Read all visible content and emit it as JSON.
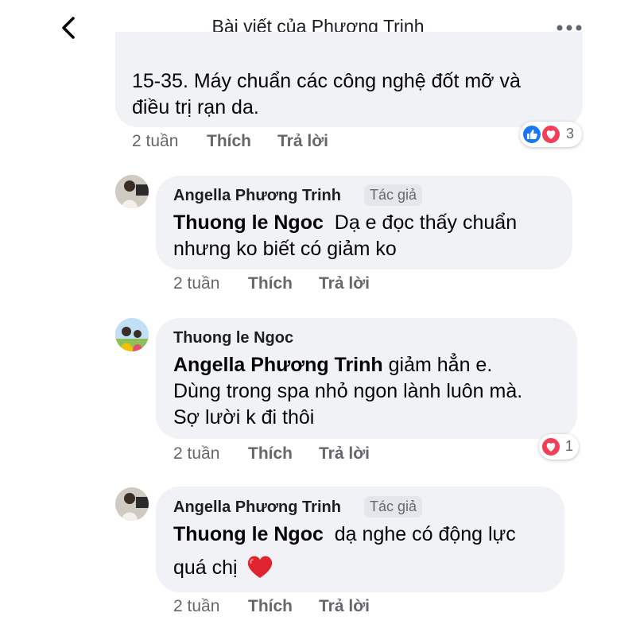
{
  "header": {
    "title": "Bài viết của Phương Trinh",
    "back_icon": "chevron-left-icon",
    "more_icon": "more-dots-icon"
  },
  "comments": [
    {
      "text_lines": [
        "15-35. Máy chuẩn các công nghệ đốt mỡ và",
        "điều trị rạn da."
      ],
      "time": "2 tuần",
      "like": "Thích",
      "reply": "Trả lời",
      "reactions": {
        "icons": [
          "like-icon",
          "heart-icon"
        ],
        "count": "3"
      }
    },
    {
      "author": "Angella Phương Trinh",
      "badge": "Tác giả",
      "mention": "Thuong le Ngoc",
      "line1": "Dạ e đọc thấy chuẩn",
      "line2": "nhưng ko biết có giảm ko",
      "time": "2 tuần",
      "like": "Thích",
      "reply": "Trả lời"
    },
    {
      "author": "Thuong le Ngoc",
      "mention": "Angella Phương Trinh",
      "line1": "giảm hẳn e.",
      "line2": "Dùng trong spa nhỏ ngon lành luôn mà.",
      "line3": "Sợ lười k đi thôi",
      "time": "2 tuần",
      "like": "Thích",
      "reply": "Trả lời",
      "reactions": {
        "icons": [
          "heart-icon"
        ],
        "count": "1"
      }
    },
    {
      "author": "Angella Phương Trinh",
      "badge": "Tác giả",
      "mention": "Thuong le Ngoc",
      "line1": "dạ nghe có động lực",
      "line2": "quá chị",
      "emoji": "red-heart-emoji",
      "time": "2 tuần",
      "like": "Thích",
      "reply": "Trả lời"
    }
  ]
}
